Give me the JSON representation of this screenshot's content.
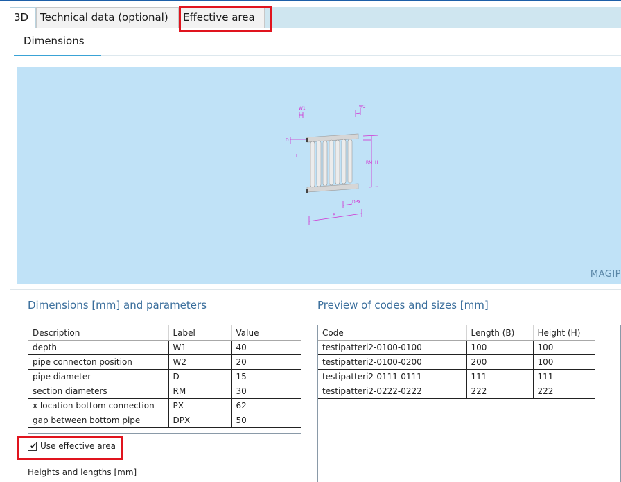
{
  "tabs": [
    {
      "label": "3D",
      "active": true
    },
    {
      "label": "Technical data (optional)",
      "active": false
    },
    {
      "label": "Effective area",
      "active": false,
      "highlighted": true
    }
  ],
  "subtab": {
    "label": "Dimensions"
  },
  "viewport": {
    "brand": "MAGIP",
    "background": "#c0e2f7",
    "dim_labels": [
      "W1",
      "W2",
      "D",
      "H",
      "RM",
      "B",
      "DPX"
    ]
  },
  "dimensions": {
    "title": "Dimensions [mm] and parameters",
    "columns": [
      "Description",
      "Label",
      "Value"
    ],
    "rows": [
      [
        "depth",
        "W1",
        "40"
      ],
      [
        "pipe connecton position",
        "W2",
        "20"
      ],
      [
        "pipe diameter",
        "D",
        "15"
      ],
      [
        "section diameters",
        "RM",
        "30"
      ],
      [
        "x location bottom connection",
        "PX",
        "62"
      ],
      [
        "gap between bottom pipe",
        "DPX",
        "50"
      ]
    ]
  },
  "preview": {
    "title": "Preview of codes and sizes [mm]",
    "columns": [
      "Code",
      "Length (B)",
      "Height (H)"
    ],
    "rows": [
      [
        "testipatteri2-0100-0100",
        "100",
        "100"
      ],
      [
        "testipatteri2-0100-0200",
        "200",
        "100"
      ],
      [
        "testipatteri2-0111-0111",
        "111",
        "111"
      ],
      [
        "testipatteri2-0222-0222",
        "222",
        "222"
      ]
    ]
  },
  "effective_area": {
    "label": "Use effective area",
    "checked": true,
    "checkmark": "✔"
  },
  "heights_label": "Heights and lengths [mm]",
  "colors": {
    "accent": "#3aa3d6",
    "highlight": "#e0141e",
    "section_title": "#3a6e9c",
    "dim_line": "#d12fd1"
  }
}
